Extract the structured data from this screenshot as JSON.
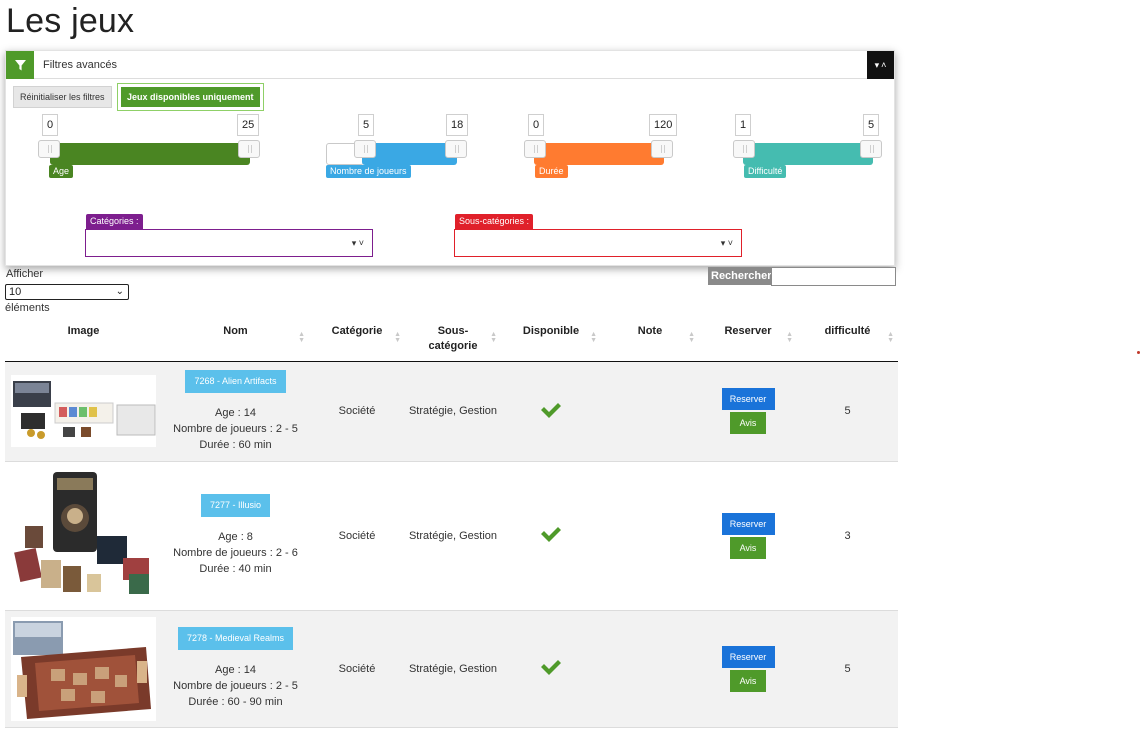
{
  "page": {
    "title": "Les jeux"
  },
  "filters": {
    "header_title": "Filtres avancés",
    "reset_label": "Réinitialiser les filtres",
    "available_label": "Jeux disponibles uniquement",
    "ranges": [
      {
        "label": "Age",
        "min": "0",
        "max": "25",
        "color": "#4a8522"
      },
      {
        "label": "Nombre de joueurs",
        "min": "5",
        "max": "18",
        "color": "#3aa8e4"
      },
      {
        "label": "Durée",
        "min": "0",
        "max": "120",
        "color": "#ff7b30"
      },
      {
        "label": "Difficulté",
        "min": "1",
        "max": "5",
        "color": "#45bcb0"
      }
    ],
    "categories": {
      "label": "Catégories :",
      "value": "",
      "color": "#7d1e8e"
    },
    "subcategories": {
      "label": "Sous-catégories :",
      "value": "",
      "color": "#e0202a"
    }
  },
  "table_controls": {
    "length_label_before": "Afficher",
    "length_value": "10",
    "length_label_after": "éléments",
    "search_label": "Rechercher :",
    "search_value": ""
  },
  "table": {
    "headers": [
      "Image",
      "Nom",
      "Catégorie",
      "Sous-catégorie",
      "Disponible",
      "Note",
      "Reserver",
      "difficulté"
    ],
    "headers_split": {
      "subcat_line1": "Sous-",
      "subcat_line2": "catégorie"
    },
    "rows": [
      {
        "name": "7268 - Alien Artifacts",
        "age": "Age : 14",
        "players": "Nombre de joueurs : 2 - 5",
        "duration": "Durée : 60 min",
        "category": "Société",
        "subcategory": "Stratégie, Gestion",
        "available": "✔",
        "note": "",
        "reserve_label": "Reserver",
        "avis_label": "Avis",
        "difficulty": "5"
      },
      {
        "name": "7277 - Illusio",
        "age": "Age : 8",
        "players": "Nombre de joueurs : 2 - 6",
        "duration": "Durée : 40 min",
        "category": "Société",
        "subcategory": "Stratégie, Gestion",
        "available": "✔",
        "note": "",
        "reserve_label": "Reserver",
        "avis_label": "Avis",
        "difficulty": "3"
      },
      {
        "name": "7278 - Medieval Realms",
        "age": "Age : 14",
        "players": "Nombre de joueurs : 2 - 5",
        "duration": "Durée : 60 - 90 min",
        "category": "Société",
        "subcategory": "Stratégie, Gestion",
        "available": "✔",
        "note": "",
        "reserve_label": "Reserver",
        "avis_label": "Avis",
        "difficulty": "5"
      }
    ]
  },
  "colors": {
    "green": "#4f9a2a",
    "blue_button": "#1a73d9",
    "badge_blue": "#5bc0eb"
  }
}
